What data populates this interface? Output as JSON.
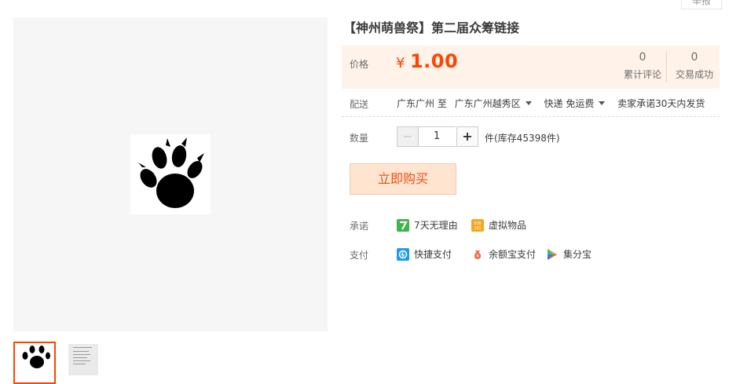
{
  "top_link": "举报",
  "title": "【神州萌兽祭】第二届众筹链接",
  "price": {
    "label": "价格",
    "currency": "¥",
    "value": "1.00"
  },
  "stats": [
    {
      "value": "0",
      "label": "累计评论"
    },
    {
      "value": "0",
      "label": "交易成功"
    }
  ],
  "delivery": {
    "label": "配送",
    "from": "广东广州 至",
    "to": "广东广州越秀区",
    "method": "快递 免运费",
    "promise": "卖家承诺30天内发货"
  },
  "quantity": {
    "label": "数量",
    "minus": "−",
    "value": "1",
    "plus": "+",
    "stock_text": "件(库存45398件)"
  },
  "buy_button": "立即购买",
  "promise": {
    "label": "承诺",
    "items": [
      "7天无理由",
      "虚拟物品"
    ]
  },
  "payment": {
    "label": "支付",
    "items": [
      "快捷支付",
      "余额宝支付",
      "集分宝"
    ]
  },
  "colors": {
    "accent": "#ff4400",
    "price_bg": "#fff2e8",
    "buy_bg": "#ffe4d0"
  },
  "icons": [
    "paw-print-image",
    "7-day-icon",
    "virtual-goods-icon",
    "quick-pay-icon",
    "yuebao-icon",
    "jifenbao-icon",
    "caret-down-icon"
  ]
}
